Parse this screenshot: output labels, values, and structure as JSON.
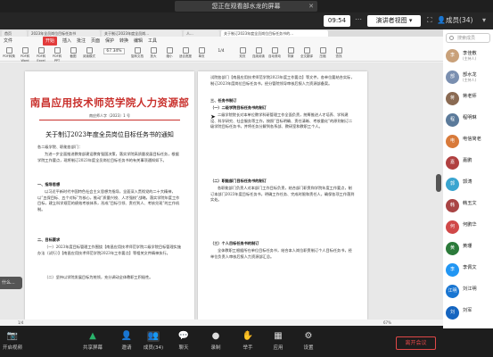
{
  "banner": {
    "text": "您正在观看部水龙的屏幕"
  },
  "topbar": {
    "time": "09:54",
    "view_label": "演讲者视图",
    "member_label": "成员(34)"
  },
  "document": {
    "tabs": [
      "首页",
      "2023年全员岗位目标任务书",
      "关于制订2023年度全员岗...",
      "人...",
      "关于制订2023年度全员岗位目标任务书的..."
    ],
    "menus": [
      "文件",
      "开始",
      "插入",
      "批注",
      "页面",
      "保护",
      "转换",
      "编辑",
      "工具"
    ],
    "start_menu": "开始",
    "tools": [
      "PDF转换",
      "PDF转Word",
      "PDF转Excel",
      "PDF转PPT",
      "截图",
      "阅读模式",
      "旋转文档",
      "放大",
      "缩小",
      "适合宽度",
      "单页",
      "双页",
      "连续阅读",
      "自动滚动",
      "背景",
      "全文翻译",
      "压缩",
      "查找"
    ],
    "zoom": "67.34%",
    "page_indicator": "1/4",
    "title": "南昌应用技术师范学院人力资源部",
    "ref": "南应师人字〔2023〕1 号",
    "subtitle": "关于制订2023年度全员岗位目标任务书的通知",
    "left_text": [
      "各二级学院、职能各部门：",
      "为进一步全面推进教育部建设教育强国决策，落实学院高质量发展目标任务，根据学院工作要点，现将制订2023年度全员岗位目标任务书的有关事项通知如下。",
      "一、指导思想",
      "以习近平新时代中国特色社会主义思想为指导，全面深入贯彻党的二十大精神，以“五保目标、五个对标”为核心，推动“质量兴校、人才强校”战略，落实学院年度工作目标，建立科学规范的绩效考核体系，形成“目标引领、责任到人、考核兑现”的工作机制。",
      "二、目标要求",
      "（一）2023年度目标管理工作围绕【南昌应用技术师范学院二级学院目标管理实施办法（试行）】【南昌应用技术师范学院2023年工作要点】等相关文件精神执行。",
      "（二）坚持以学院发展目标为统领，充分调动全体教职工积极性。"
    ],
    "right_text": [
      "试院各部门【南昌应用技术师范学院2023年度工作要点】等文件，各单位要结合实际，制订2023年度岗位目标任务书，经分管院领导审核后报人力资源部备案。",
      "三、任务书制订",
      "（一）二级学院目标任务书的制订",
      "二级学院院长对本单位教学科研管理工作全面负责，统筹推进人才培养、学科建设、科学研究、社会服务等工作，按照“目标明确、责任清晰、考核量化”的原则制订二级学院目标任务书，并将任务分解到各系部、教研室和教职工个人。",
      "（二）职能部门目标任务书的制订",
      "各职能部门负责人对本部门工作目标负责，结合部门职责和学院年度工作要点，制订本部门2023年度目标任务书，明确工作任务、完成时限和责任人，确保各项工作落到实处。",
      "（三）个人目标任务书的制订",
      "全体教职工根据所在单位目标任务书，结合本人岗位职责制订个人目标任务书，经单位负责人审核后报人力资源部汇总。"
    ],
    "status_page": "1/4",
    "status_zoom": "67%"
  },
  "left_tip": "什么...",
  "participants": {
    "search_placeholder": "搜索成员",
    "items": [
      {
        "name": "李佳敷",
        "sub": "(主持人)",
        "avatar": "李",
        "color": "#c9a17a"
      },
      {
        "name": "部水龙",
        "sub": "(主持人)",
        "avatar": "部",
        "color": "#7a8fb0"
      },
      {
        "name": "蒋老师",
        "sub": "",
        "avatar": "蒋",
        "color": "#8a6a52"
      },
      {
        "name": "程明琳",
        "sub": "",
        "avatar": "程",
        "color": "#5b7a9a"
      },
      {
        "name": "电信简老",
        "sub": "",
        "avatar": "电",
        "color": "#d87a3a"
      },
      {
        "name": "嘉鹏",
        "sub": "",
        "avatar": "嘉",
        "color": "#b04040"
      },
      {
        "name": "郭涛",
        "sub": "",
        "avatar": "郭",
        "color": "#3aa5d0"
      },
      {
        "name": "韩玉文",
        "sub": "",
        "avatar": "韩",
        "color": "#a94444"
      },
      {
        "name": "何鹏华",
        "sub": "",
        "avatar": "何",
        "color": "#d04848"
      },
      {
        "name": "黄珊",
        "sub": "",
        "avatar": "黄",
        "color": "#2b7a3a"
      },
      {
        "name": "李佩文",
        "sub": "",
        "avatar": "李",
        "color": "#2196f3"
      },
      {
        "name": "刘江明",
        "sub": "",
        "avatar": "江明",
        "color": "#1976d2"
      },
      {
        "name": "刘军",
        "sub": "",
        "avatar": "刘",
        "color": "#1565c0"
      }
    ]
  },
  "bottom": {
    "buttons": [
      "开启视频",
      "共享屏幕",
      "邀请",
      "成员(34)",
      "聊天",
      "录制",
      "举手",
      "应用",
      "设置"
    ],
    "leave": "离开会议"
  }
}
